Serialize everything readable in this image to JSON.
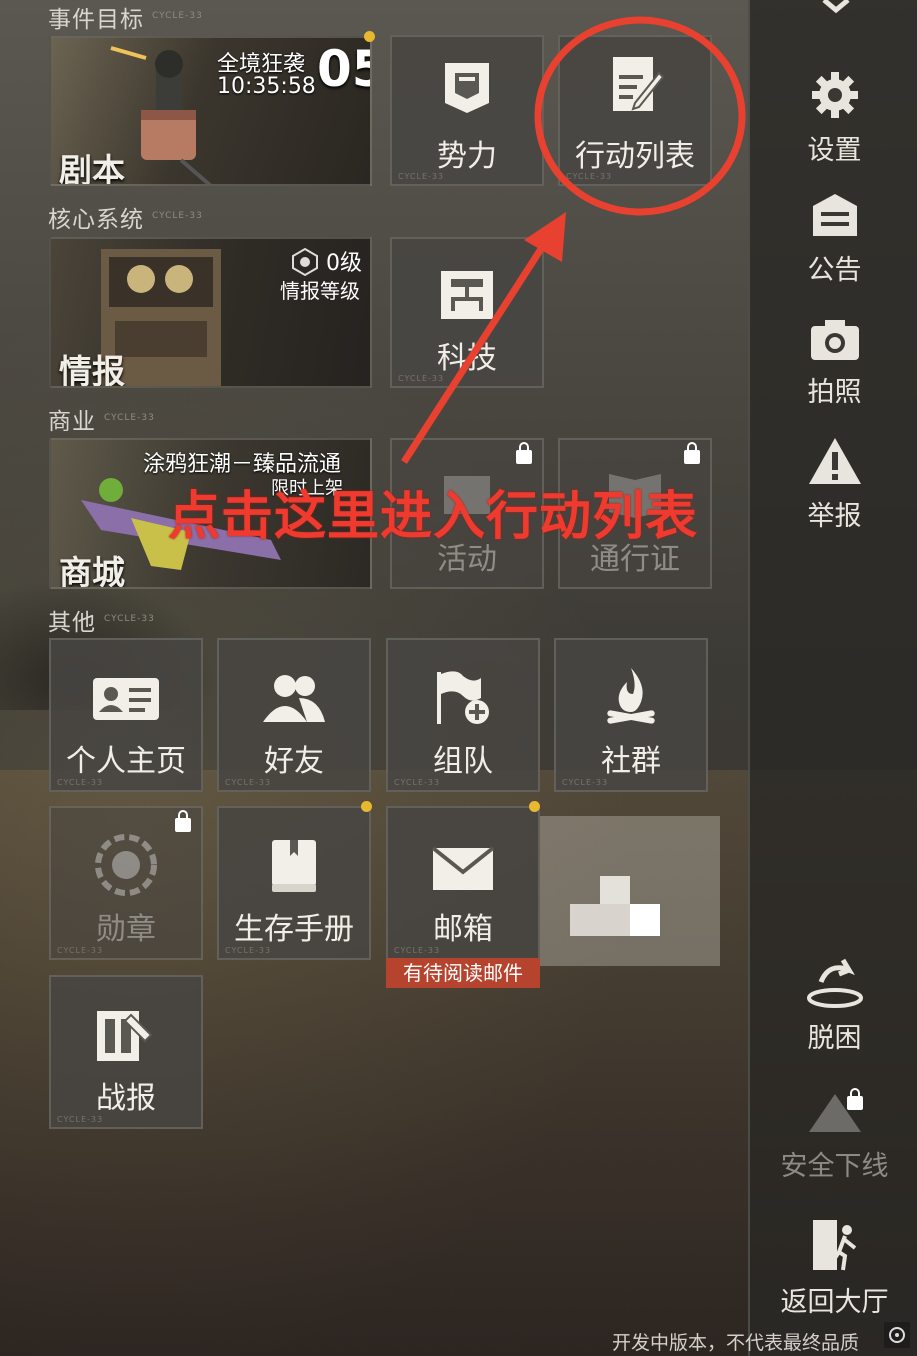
{
  "sections": {
    "event": "事件目标",
    "core": "核心系统",
    "commerce": "商业",
    "other": "其他",
    "cycle": "CYCLE-33"
  },
  "event_banner": {
    "name": "全境狂袭",
    "count": "05",
    "timer": "10:35:58",
    "label": "剧本"
  },
  "intel_banner": {
    "level": "0级",
    "level_caption": "情报等级",
    "label": "情报"
  },
  "shop_banner": {
    "promo": "涂鸦狂潮－臻品流通",
    "promo_sub": "限时上架",
    "label": "商城"
  },
  "tiles": {
    "faction": "势力",
    "action_list": "行动列表",
    "tech": "科技",
    "activity": "活动",
    "pass": "通行证",
    "profile": "个人主页",
    "friends": "好友",
    "team": "组队",
    "community": "社群",
    "medal": "勋章",
    "manual": "生存手册",
    "mail": "邮箱",
    "mail_badge": "有待阅读邮件",
    "battle_report": "战报"
  },
  "sidebar": {
    "settings": "设置",
    "notice": "公告",
    "photo": "拍照",
    "report": "举报",
    "escape": "脱困",
    "safe_logout": "安全下线",
    "return_lobby": "返回大厅"
  },
  "footer": "开发中版本，不代表最终品质",
  "annotation": "点击这里进入行动列表",
  "colors": {
    "annotation": "#e8412f",
    "badge": "#b5432e",
    "notify_dot": "#e8b830"
  }
}
